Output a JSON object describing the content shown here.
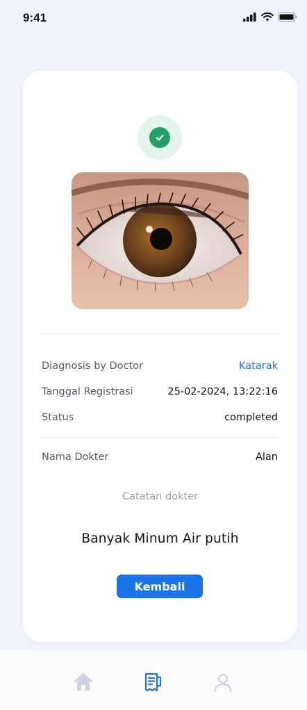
{
  "status_bar": {
    "time": "9:41"
  },
  "result": {
    "status_icon": "check-circle-icon",
    "image_alt": "eye-photo",
    "details": [
      {
        "label": "Diagnosis by Doctor",
        "value": "Katarak",
        "accent": true
      },
      {
        "label": "Tanggal Registrasi",
        "value": "25-02-2024, 13:22:16",
        "accent": false
      },
      {
        "label": "Status",
        "value": "completed",
        "accent": false
      }
    ],
    "doctor": {
      "label": "Nama Dokter",
      "value": "Alan"
    },
    "notes_label": "Catatan dokter",
    "notes_text": "Banyak Minum Air putih",
    "back_button": "Kembali"
  },
  "bottom_nav": {
    "items": [
      {
        "icon": "home-icon",
        "active": false
      },
      {
        "icon": "receipt-icon",
        "active": true
      },
      {
        "icon": "user-icon",
        "active": false
      }
    ]
  },
  "colors": {
    "accent": "#1a73e8",
    "success": "#21a064",
    "background": "#eef3fd"
  }
}
